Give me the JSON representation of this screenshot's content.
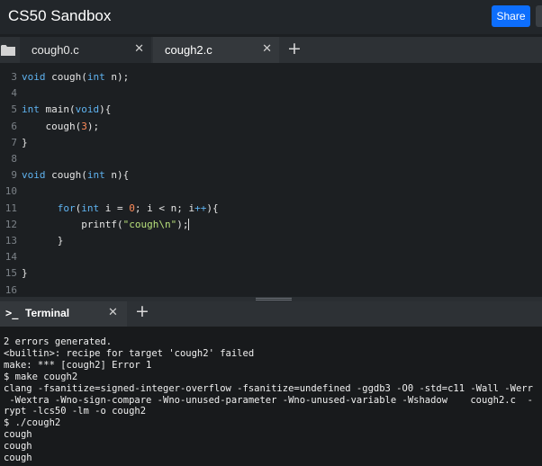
{
  "app": {
    "title": "CS50 Sandbox",
    "share_label": "Share"
  },
  "tabs": [
    {
      "label": "cough0.c",
      "close": "✕"
    },
    {
      "label": "cough2.c",
      "close": "✕"
    }
  ],
  "add_tab_glyph": "+",
  "editor": {
    "active_file": "cough2.c",
    "lines": [
      {
        "n": "3",
        "text": "void cough(int n);"
      },
      {
        "n": "4",
        "text": ""
      },
      {
        "n": "5",
        "text": "int main(void){"
      },
      {
        "n": "6",
        "text": "    cough(3);"
      },
      {
        "n": "7",
        "text": "}"
      },
      {
        "n": "8",
        "text": ""
      },
      {
        "n": "9",
        "text": "void cough(int n){"
      },
      {
        "n": "10",
        "text": ""
      },
      {
        "n": "11",
        "text": "      for(int i = 0; i < n; i++){"
      },
      {
        "n": "12",
        "text": "          printf(\"cough\\n\");"
      },
      {
        "n": "13",
        "text": "      }"
      },
      {
        "n": "14",
        "text": ""
      },
      {
        "n": "15",
        "text": "}"
      },
      {
        "n": "16",
        "text": ""
      }
    ]
  },
  "terminal": {
    "tab_icon": ">_",
    "tab_label": "Terminal",
    "close": "✕",
    "add": "+",
    "lines": [
      "2 errors generated.",
      "<builtin>: recipe for target 'cough2' failed",
      "make: *** [cough2] Error 1",
      "$ make cough2",
      "clang -fsanitize=signed-integer-overflow -fsanitize=undefined -ggdb3 -O0 -std=c11 -Wall -Werr",
      " -Wextra -Wno-sign-compare -Wno-unused-parameter -Wno-unused-variable -Wshadow    cough2.c  -",
      "rypt -lcs50 -lm -o cough2",
      "$ ./cough2",
      "cough",
      "cough",
      "cough"
    ]
  },
  "colors": {
    "accent": "#0d6efd",
    "keyword": "#5fb3f0",
    "number": "#ff8c5a",
    "string": "#b7e07b"
  }
}
